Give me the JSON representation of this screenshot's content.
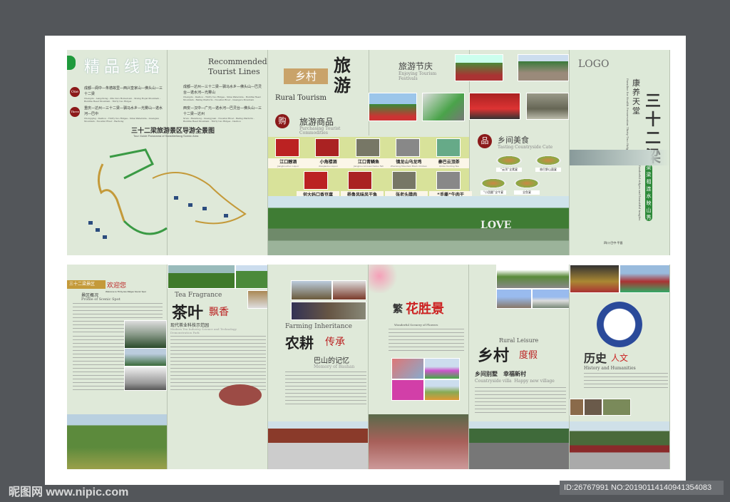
{
  "routes": {
    "title_cn": "精品线路",
    "title_en": "Recommended Tourist Lines",
    "badge1": "One",
    "badge2": "Three",
    "r1": "成都—阆中—朱德故里—西兴皇家山—佛头山—三十二梁",
    "r1_en": "Chengdu - Langzhong - Zhu De's Hometown - Xixing Royal Mountain - Buddha Head Mountain - Thirty two Ridges",
    "r2": "重庆—达州—三十二梁—驷马水乡—光雾山—诺水河—巴中",
    "r2_en": "Chongqing - Dazhou - Thirty two Ridges - Sima Waterside - Guangwu Mountain - Nuoshui River - Bazhong",
    "r3": "成都—达州—三十二梁—驷马水乡—佛头山—巴灵台—诺水河—光雾山",
    "r3_en": "Chengdu - Dazhou - Thirty two Ridges - Sima Waterside - Buddha Head Mountain - Baling Platform - Nuoshui River - Guangwu Mountain",
    "r4": "西安—汉中—广元—诺水河—巴灵台—佛头山—三十二梁—达州",
    "r4_en": "Xi'an - Hanzhong - Guangyuan - Nuoshui River - Baling Platform - Buddha Head Mountain - Thirty two Ridges - Dazhou",
    "map_title": "三十二梁旅游景区导游全景图",
    "map_title_en": "Tour Guide Panorama of Sanshierliang Scenic Area"
  },
  "rural": {
    "title_box": "乡村",
    "title_big": "旅游",
    "title_en": "Rural Tourism",
    "shop_icon": "购",
    "shop_cn": "旅游商品",
    "shop_en": "Purchasing Tourist Commodities",
    "products": [
      {
        "cn": "江口醇酒",
        "en": "Jiangkouchun Liquor"
      },
      {
        "cn": "小角楼酒",
        "en": "Xiaojiaolou Liquor"
      },
      {
        "cn": "江口青鳞鱼",
        "en": "Jiangkou Acrossocheilus fish"
      },
      {
        "cn": "镇龙山乌龙鸡",
        "en": "Zhenlong Mountain Black Chicken"
      },
      {
        "cn": "秦巴云顶茶",
        "en": "Qinba Yunding Tea"
      },
      {
        "cn": "何大妈口香豆腐",
        "en": "Hedama Doufuru"
      },
      {
        "cn": "杨鲁风味风干鱼",
        "en": "Yang's Flavor Dried Fish"
      },
      {
        "cn": "张老头腊肉",
        "en": "Zhanglaotou Preserved Meat"
      },
      {
        "cn": "“手撕”牛肉干",
        "en": "\"Hand-torn\" Dried Beef"
      }
    ],
    "festival_cn": "旅游节庆",
    "festival_en": "Enjoying Tourism Festivals",
    "food_icon": "品",
    "food_cn": "乡间美食",
    "food_en": "Tasting Countryside Cate",
    "dishes": [
      "“云顶”全素宴",
      "香巴野山菌宴",
      "“小团圆”全牛宴",
      "全鱼宴"
    ],
    "love": "LOVE"
  },
  "cover": {
    "logo": "LOGO",
    "sub": "康养天堂",
    "title": "三十二梁",
    "en1": "Paradise for Health Preservation Thirty-Two Ridges",
    "slogan": "梁梁相连 水映山秀",
    "en2": "Wonderful ridges and beautiful tangles",
    "place": "四川·巴中·平昌"
  },
  "welcome": {
    "banner": "三十二梁景区",
    "banner2": "欢迎您",
    "banner_en": "Welcome to Thirty-two Ridges Scenic Spot",
    "h_cn": "景区概况",
    "h_en": "Profile of Scenic Spot"
  },
  "tea": {
    "en": "Tea Fragrance",
    "cn1": "茶叶",
    "cn2": "飘香",
    "sub_cn": "现代茶业科技示范园",
    "sub_en": "Modern Tea Industry Science and Technology Demonstration Park"
  },
  "farm": {
    "en": "Farming Inheritance",
    "cn1": "农耕",
    "cn2": "传承",
    "sub_cn": "巴山的记忆",
    "sub_en": "Memory of Bashan"
  },
  "flower": {
    "cn1": "繁",
    "cn2": "花胜景",
    "en": "Wonderful Scenery of Flowers"
  },
  "leisure": {
    "en": "Rural Leisure",
    "cn1": "乡村",
    "cn2": "度假",
    "sub_cn": "乡间别墅　幸福新村",
    "sub_en": "Countryside villa  Happy new village"
  },
  "history": {
    "cn1": "历史",
    "cn2": "人文",
    "en": "History and Humanities"
  },
  "watermark": {
    "site": "昵图网 www.nipic.com",
    "id": "ID:26767991 NO:20190114140941354083"
  }
}
